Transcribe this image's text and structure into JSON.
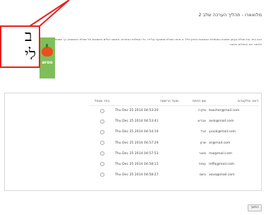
{
  "page": {
    "title": "מלואארו - תהליך הערכה שלב 2",
    "instructions": "אנא בחר את מטלת בעיגון תשובת כמטפלת התשובות בתרון-כלל. צ תחזה מטלת שתוצעה על-ידי. כל הטפלות האחרות. נתשובו יכולים בתשובות אל מטלת התשובות, כך שמטפלתן לאשים לב ולבחור את הטפלות הטובה"
  },
  "logo": {
    "text": "aroo",
    "brand_color": "#7fbf5a",
    "apple_color": "#e8501e"
  },
  "callout": {
    "line1": "ב",
    "line2": "לי",
    "border_color": "#e82020"
  },
  "table": {
    "headers": {
      "email": "דואר אלקטרוני",
      "pet": "שם החיות",
      "date": "מועד הרשמה",
      "select": "בחר מטפל"
    },
    "rows": [
      {
        "email": "teacher@mail.com",
        "pet": "מיקרו",
        "date": "Thu Dec 25 2014 04:53:20"
      },
      {
        "email": "avio@mail.com",
        "pet": "אברש",
        "date": "Thu Dec 25 2014 04:53:41"
      },
      {
        "email": "yuval@mail.com",
        "pet": "יובל",
        "date": "Thu Dec 25 2014 04:54:10"
      },
      {
        "email": "ar@mail.com",
        "pet": "שרון",
        "date": "Thu Dec 25 2014 04:57:29"
      },
      {
        "email": "ma@mail.com",
        "pet": "מאור",
        "date": "Thu Dec 25 2014 04:57:53"
      },
      {
        "email": "mffa@mail.com",
        "pet": "עמית",
        "date": "Thu Dec 25 2014 04:58:11"
      },
      {
        "email": "xova@mail.com",
        "pet": "נחום",
        "date": "Thu Dec 25 2014 04:58:27"
      }
    ]
  },
  "submit_label": "המשך"
}
